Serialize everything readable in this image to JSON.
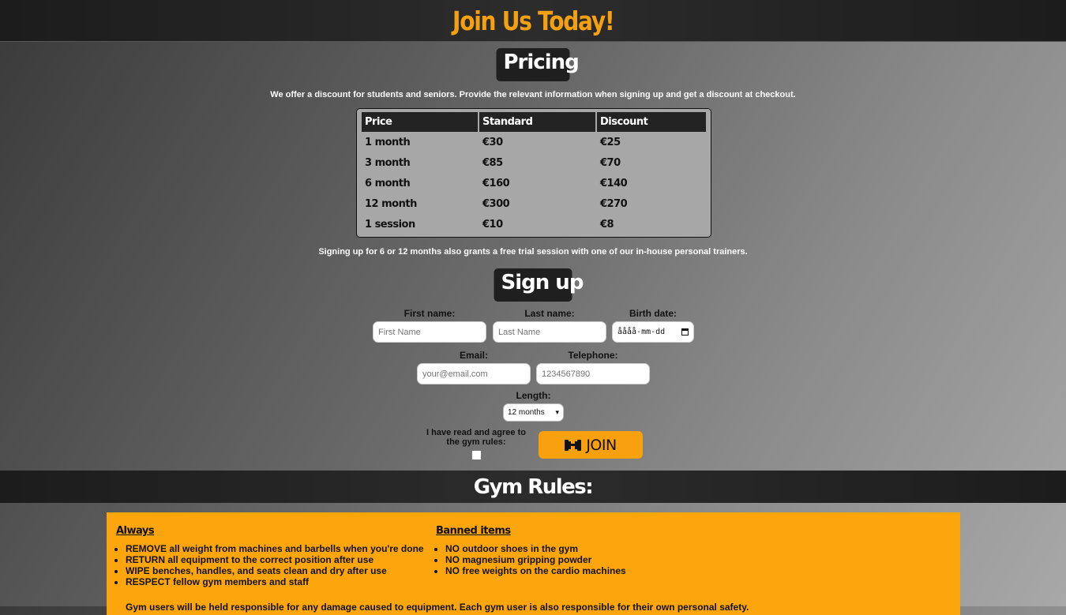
{
  "header": {
    "title": "Join Us Today!"
  },
  "pricing": {
    "heading": "Pricing",
    "intro": "We offer a discount for students and seniors. Provide the relevant information when signing up and get a discount at checkout.",
    "columns": [
      "Price",
      "Standard",
      "Discount"
    ],
    "rows": [
      [
        "1 month",
        "€30",
        "€25"
      ],
      [
        "3 month",
        "€85",
        "€70"
      ],
      [
        "6 month",
        "€160",
        "€140"
      ],
      [
        "12 month",
        "€300",
        "€270"
      ],
      [
        "1 session",
        "€10",
        "€8"
      ]
    ],
    "note": "Signing up for 6 or 12 months also grants a free trial session with one of our in-house personal trainers."
  },
  "signup": {
    "heading": "Sign up",
    "first_name": {
      "label": "First name:",
      "placeholder": "First Name"
    },
    "last_name": {
      "label": "Last name:",
      "placeholder": "Last Name"
    },
    "birth_date": {
      "label": "Birth date:",
      "value": "åååå-mm-dd"
    },
    "email": {
      "label": "Email:",
      "placeholder": "your@email.com"
    },
    "telephone": {
      "label": "Telephone:",
      "placeholder": "1234567890"
    },
    "length": {
      "label": "Length:",
      "selected": "12 months"
    },
    "agree_label": "I have read and agree to the gym rules:",
    "join_label": "JOIN",
    "join_icon": "dumbbell-icon"
  },
  "rules": {
    "heading": "Gym Rules:",
    "always": {
      "title": "Always",
      "items": [
        "REMOVE all weight from machines and barbells when you're done",
        "RETURN all equipment to the correct position after use",
        "WIPE benches, handles, and seats clean and dry after use",
        "RESPECT fellow gym members and staff"
      ]
    },
    "banned": {
      "title": "Banned items",
      "items": [
        "NO outdoor shoes in the gym",
        "NO magnesium gripping powder",
        "NO free weights on the cardio machines"
      ]
    },
    "note": "Gym users will be held responsible for any damage caused to equipment. Each gym user is also responsible for their own personal safety."
  },
  "colors": {
    "accent": "#f9a00e",
    "dark": "#1f1f1f"
  }
}
